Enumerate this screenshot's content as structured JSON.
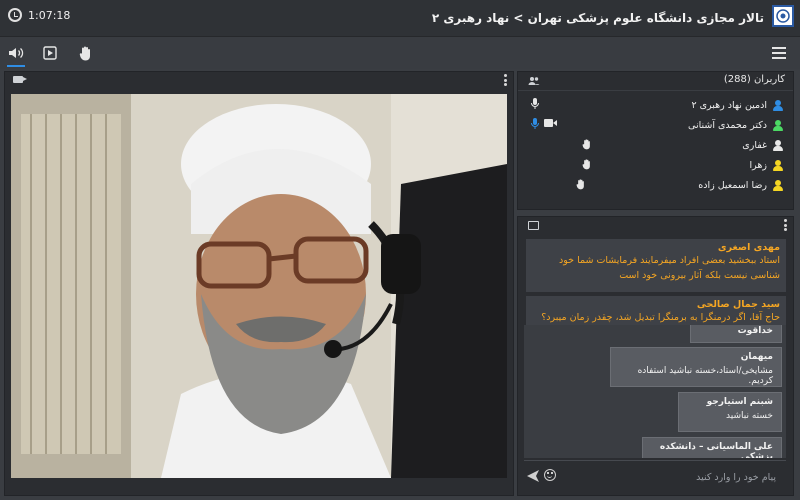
{
  "header": {
    "title": "تالار مجازی دانشگاه علوم پزشکی تهران > نهاد رهبری ۲",
    "timer": "1:07:18",
    "logo_icon": "university-logo-icon"
  },
  "toolbar": {
    "buttons": [
      {
        "icon": "speaker-icon",
        "active": true
      },
      {
        "icon": "screen-share-icon",
        "active": false
      },
      {
        "icon": "raise-hand-icon",
        "active": false
      }
    ],
    "menu_icon": "hamburger-menu-icon"
  },
  "users": {
    "title": "کاربران (288)",
    "list": [
      {
        "name": "ادمین نهاد رهبری ۲",
        "color": "#2f8de4",
        "status": "mic-icon"
      },
      {
        "name": "دکتر محمدی آشنانی",
        "color": "#4cd964",
        "status": "camera-mic-icon"
      },
      {
        "name": "غفاری",
        "color": "#e8e8e8",
        "status": "raise-hand-icon"
      },
      {
        "name": "زهرا",
        "color": "#f5d623",
        "status": "raise-hand-icon"
      },
      {
        "name": "رضا اسمعیل زاده",
        "color": "#f5d623",
        "status": "raise-hand-icon"
      }
    ]
  },
  "chat": {
    "messages": [
      {
        "name": "مهدی اصغری",
        "text": "استاد ببخشید بعضی افراد میفرمایند فرمایشات شما خود شناسی نیست بلکه آثار بیرونی خود است"
      },
      {
        "name": "سید جمال صالحی",
        "text": "حاج آقا، اگر درمنگرا به برمنگرا تبدیل شد، چقدر زمان میبرد؟"
      }
    ],
    "popups": [
      {
        "name": "",
        "text": "خداقوت"
      },
      {
        "name": "میهمان",
        "text": "مشایخی/استاد،خسته نباشید استفاده کردیم."
      },
      {
        "name": "شبنم استیارجو",
        "text": "خسته نباشید"
      },
      {
        "name": "علی الماسیانی – دانشکده پزشکی",
        "text": ""
      }
    ],
    "input_placeholder": "پیام خود را وارد کنید"
  },
  "colors": {
    "accent": "#2f8de4",
    "chat_name": "#f5a623",
    "panel_bg": "#2b2d31",
    "page_bg": "#3a3d42"
  }
}
